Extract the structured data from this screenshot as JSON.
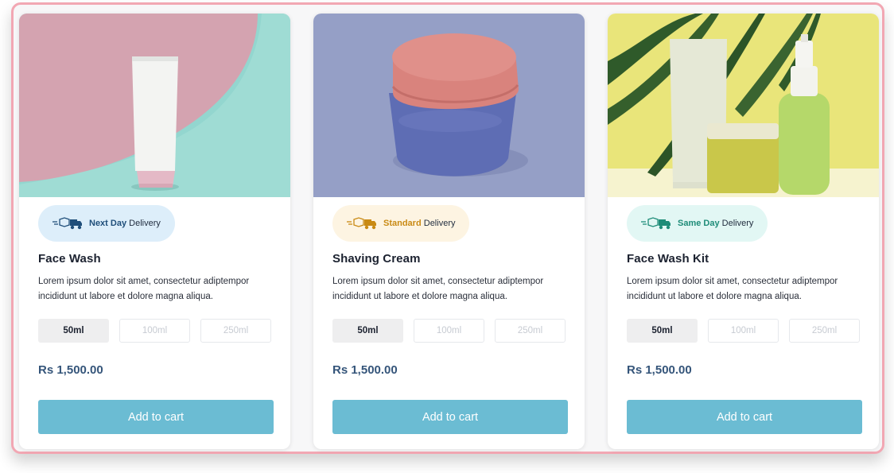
{
  "products": [
    {
      "name": "Face Wash",
      "description": "Lorem ipsum dolor sit amet, consectetur adiptempor incididunt ut labore et dolore magna aliqua.",
      "delivery": {
        "speed": "Next Day",
        "label": "Delivery",
        "color": "#1f4e7a"
      },
      "sizes": [
        "50ml",
        "100ml",
        "250ml"
      ],
      "selected_size": "50ml",
      "price": "Rs 1,500.00",
      "cta": "Add to cart"
    },
    {
      "name": "Shaving Cream",
      "description": "Lorem ipsum dolor sit amet, consectetur adiptempor incididunt ut labore et dolore magna aliqua.",
      "delivery": {
        "speed": "Standard",
        "label": "Delivery",
        "color": "#c98a14"
      },
      "sizes": [
        "50ml",
        "100ml",
        "250ml"
      ],
      "selected_size": "50ml",
      "price": "Rs 1,500.00",
      "cta": "Add to cart"
    },
    {
      "name": "Face Wash Kit",
      "description": "Lorem ipsum dolor sit amet, consectetur adiptempor incididunt ut labore et dolore magna aliqua.",
      "delivery": {
        "speed": "Same Day",
        "label": "Delivery",
        "color": "#1e8c78"
      },
      "sizes": [
        "50ml",
        "100ml",
        "250ml"
      ],
      "selected_size": "50ml",
      "price": "Rs 1,500.00",
      "cta": "Add to cart"
    }
  ],
  "theme": {
    "accent_button": "#6bbcd3",
    "price_color": "#35557a",
    "frame_border": "#f2a7b3"
  }
}
